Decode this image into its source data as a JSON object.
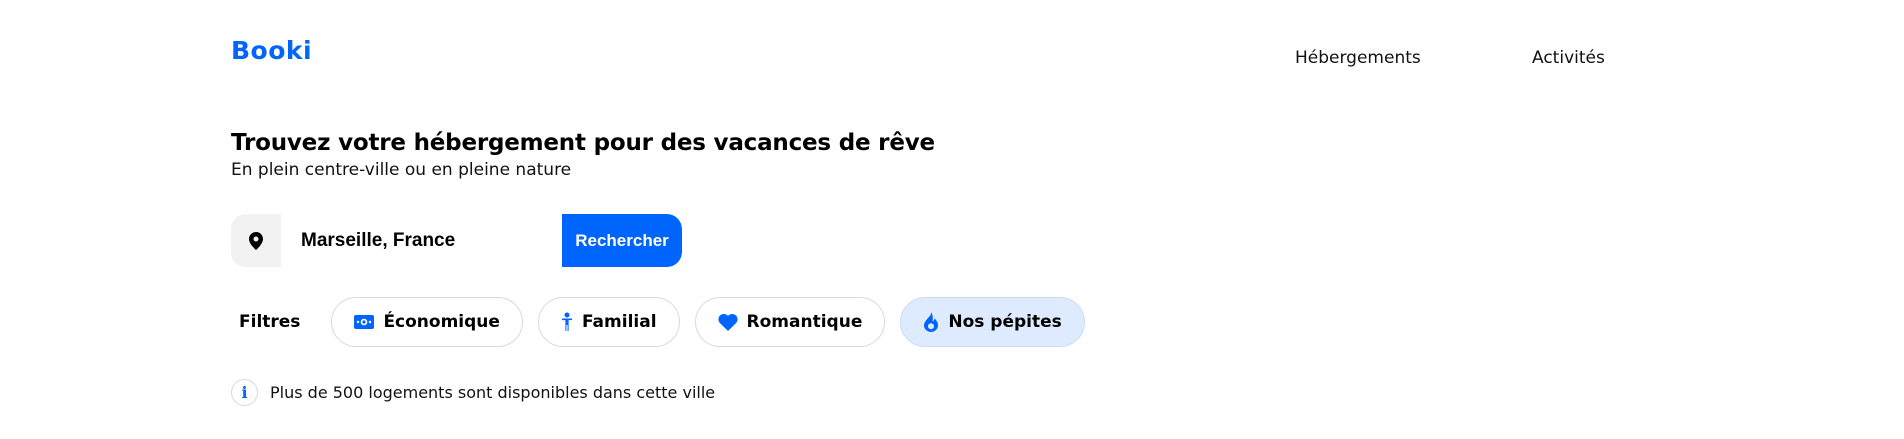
{
  "header": {
    "logo": "Booki",
    "nav": [
      {
        "label": "Hébergements"
      },
      {
        "label": "Activités"
      }
    ]
  },
  "hero": {
    "title": "Trouvez votre hébergement pour des vacances de rêve",
    "subtitle": "En plein centre-ville ou en pleine nature"
  },
  "search": {
    "icon": "location-pin-icon",
    "value": "Marseille, France",
    "button_label": "Rechercher"
  },
  "filters": {
    "label": "Filtres",
    "items": [
      {
        "label": "Économique",
        "icon": "money-icon",
        "active": false
      },
      {
        "label": "Familial",
        "icon": "person-icon",
        "active": false
      },
      {
        "label": "Romantique",
        "icon": "heart-icon",
        "active": false
      },
      {
        "label": "Nos pépites",
        "icon": "fire-icon",
        "active": true
      }
    ]
  },
  "info": {
    "icon": "info-icon",
    "text": "Plus de 500 logements sont disponibles dans cette ville"
  },
  "colors": {
    "primary": "#0065FC",
    "active_chip_bg": "#DEEBFF",
    "pin_bg": "#F2F2F2"
  }
}
